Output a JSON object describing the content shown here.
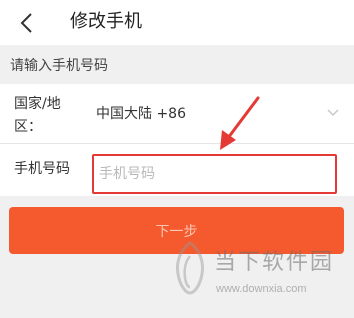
{
  "nav": {
    "title": "修改手机",
    "back_icon": "chevron-left-icon"
  },
  "form": {
    "section_hint": "请输入手机号码",
    "country": {
      "label": "国家/地区：",
      "value": "中国大陆 +86",
      "dropdown_icon": "chevron-down-icon"
    },
    "phone": {
      "label": "手机号码",
      "value": "",
      "placeholder": "手机号码"
    }
  },
  "actions": {
    "next_label": "下一步"
  },
  "annotation": {
    "type": "arrow",
    "color": "#e53935"
  },
  "watermark": {
    "brand": "当下软件园",
    "url": "www.downxia.com"
  },
  "colors": {
    "accent": "#f45a2d",
    "highlight": "#e53935",
    "background": "#f0f0f0"
  }
}
